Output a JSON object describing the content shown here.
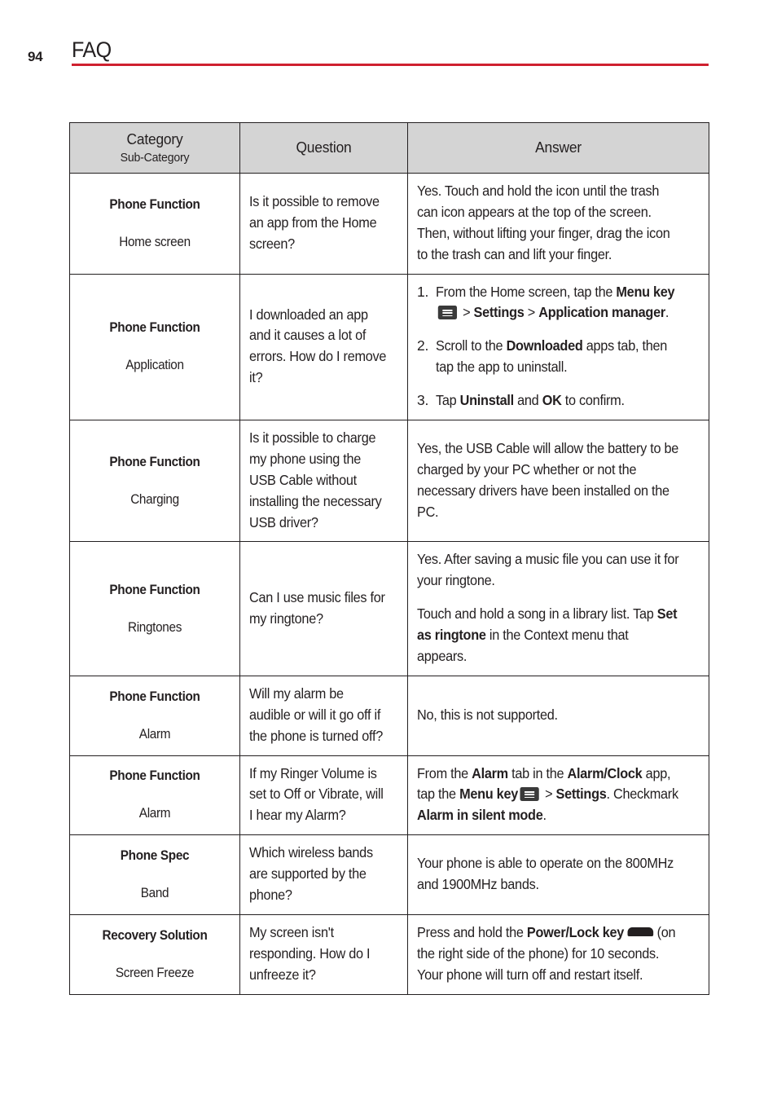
{
  "page": {
    "number": "94",
    "title": "FAQ",
    "rule_color": "#cf202f"
  },
  "table": {
    "header": {
      "category_main": "Category",
      "category_sub": "Sub-Category",
      "question": "Question",
      "answer": "Answer"
    },
    "rows": [
      {
        "category": "Phone Function",
        "sub_category": "Home screen",
        "question": "Is it possible to remove an app from the Home screen?",
        "answer_paragraphs": [
          "Yes. Touch and hold the icon until the trash can icon appears at the top of the screen. Then, without lifting your finger, drag the icon to the trash can and lift your finger."
        ]
      },
      {
        "category": "Phone Function",
        "sub_category": "Application",
        "question": "I downloaded an app and it causes a lot of errors. How do I remove it?",
        "answer_steps": [
          {
            "prefix": "From the Home screen, tap the ",
            "bold1": "Menu key",
            "icon": "menu-key-icon",
            "middle": " > ",
            "bold2": "Settings",
            "middle2": " > ",
            "bold3": "Application manager",
            "suffix": "."
          },
          {
            "prefix": "Scroll to the ",
            "bold1": "Downloaded",
            "suffix": " apps tab, then tap the app to uninstall."
          },
          {
            "prefix": "Tap ",
            "bold1": "Uninstall",
            "middle": " and ",
            "bold2": "OK",
            "suffix": " to confirm."
          }
        ]
      },
      {
        "category": "Phone Function",
        "sub_category": "Charging",
        "question": "Is it possible to charge my phone using the USB Cable without installing the necessary USB driver?",
        "answer_paragraphs": [
          "Yes, the USB Cable will allow the battery to be charged by your PC whether or not the necessary drivers have been installed on the PC."
        ]
      },
      {
        "category": "Phone Function",
        "sub_category": "Ringtones",
        "question": "Can I use music files for my ringtone?",
        "answer_paragraphs": [
          "Yes. After saving a music file you can use it for your ringtone."
        ],
        "answer_rich": {
          "prefix": "Touch and hold a song in a library list. Tap ",
          "bold": "Set as ringtone",
          "suffix": " in the Context menu that appears."
        }
      },
      {
        "category": "Phone Function",
        "sub_category": "Alarm",
        "question": "Will my alarm be audible or will it go off if the phone is turned off?",
        "answer_paragraphs": [
          "No, this is not supported."
        ]
      },
      {
        "category": "Phone Function",
        "sub_category": "Alarm",
        "question": "If my Ringer Volume is set to Off or Vibrate, will I hear my Alarm?",
        "answer_rich_alarm": {
          "p1": "From the ",
          "b1": "Alarm",
          "p2": " tab in the ",
          "b2": "Alarm/Clock",
          "p3": " app, tap the ",
          "b3": "Menu key",
          "icon": "menu-key-icon",
          "p4": " > ",
          "b4": "Settings",
          "p5": ". Checkmark ",
          "b5": "Alarm in silent mode",
          "p6": "."
        }
      },
      {
        "category": "Phone Spec",
        "sub_category": "Band",
        "question": "Which wireless bands are supported by the phone?",
        "answer_paragraphs": [
          "Your phone is able to operate on the 800MHz and 1900MHz bands."
        ]
      },
      {
        "category": "Recovery Solution",
        "sub_category": "Screen Freeze",
        "question": "My screen isn't responding. How do I unfreeze it?",
        "answer_rich_power": {
          "p1": "Press and hold the ",
          "b1": "Power/Lock key",
          "icon": "power-lock-key-icon",
          "p2": " (on the right side of the phone) for 10 seconds. Your phone will turn off and restart itself."
        }
      }
    ]
  }
}
